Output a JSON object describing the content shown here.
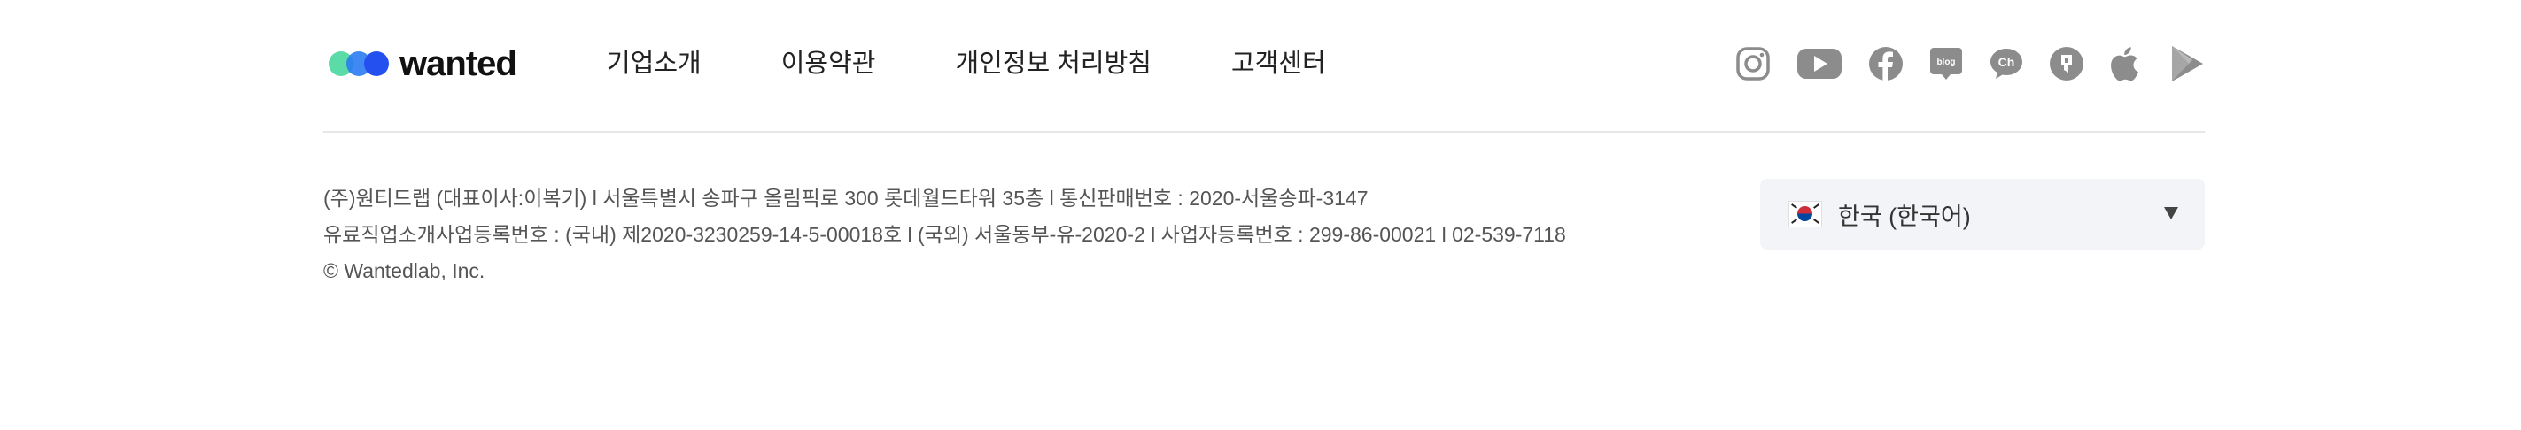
{
  "brand": {
    "name": "wanted",
    "dot_colors": [
      "#3dd598",
      "#2b7bf2",
      "#2450f0"
    ]
  },
  "nav": {
    "items": [
      {
        "label": "기업소개"
      },
      {
        "label": "이용약관"
      },
      {
        "label": "개인정보 처리방침"
      },
      {
        "label": "고객센터"
      }
    ]
  },
  "social": {
    "icons": [
      "instagram-icon",
      "youtube-icon",
      "facebook-icon",
      "blog-icon",
      "kakao-channel-icon",
      "kakao-story-icon",
      "apple-icon",
      "google-play-icon"
    ],
    "blog_label": "blog",
    "channel_label": "Ch"
  },
  "company_info": {
    "line1": "(주)원티드랩 (대표이사:이복기) l 서울특별시 송파구 올림픽로 300 롯데월드타워 35층 l 통신판매번호 : 2020-서울송파-3147",
    "line2": "유료직업소개사업등록번호 : (국내) 제2020-3230259-14-5-00018호 l (국외) 서울동부-유-2020-2 l 사업자등록번호 : 299-86-00021 l 02-539-7118",
    "copyright": "© Wantedlab, Inc."
  },
  "language": {
    "selected": "한국 (한국어)",
    "flag": "korea-flag-icon"
  },
  "colors": {
    "icon_gray": "#8c8c8c",
    "divider": "#e6e6e6",
    "lang_bg": "#f2f4f7"
  }
}
